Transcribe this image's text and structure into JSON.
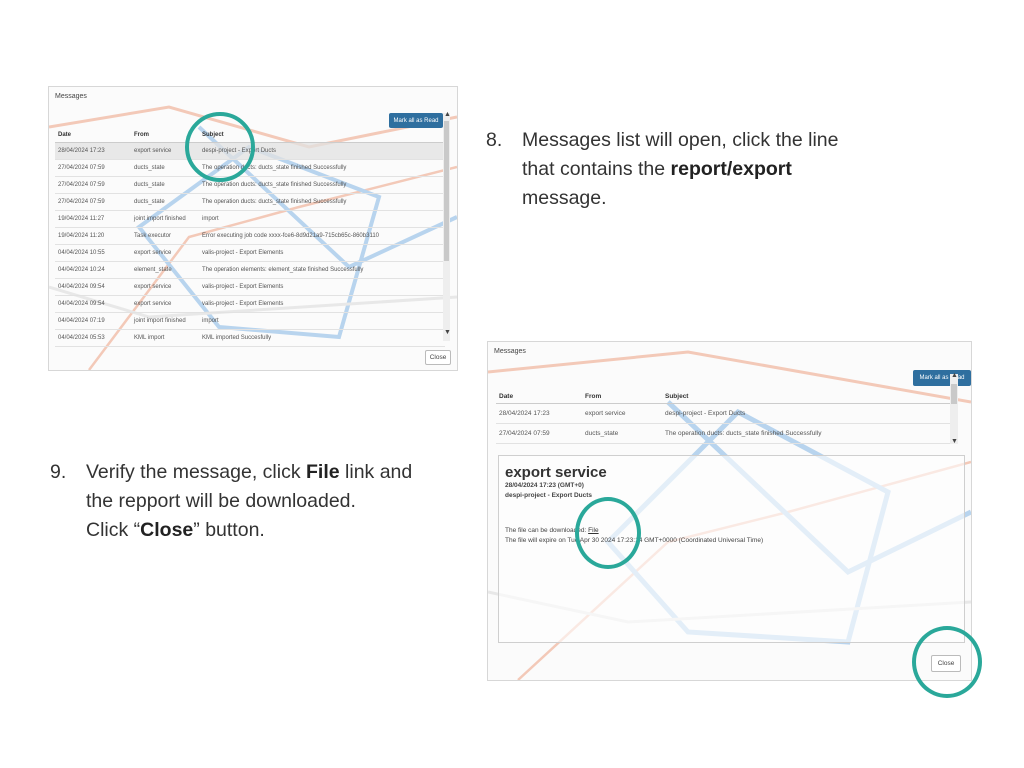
{
  "accent_color": "#2aa89a",
  "messages_dialog": {
    "title": "Messages",
    "mark_all_read": "Mark all as Read",
    "close": "Close",
    "columns": [
      "Date",
      "From",
      "Subject"
    ],
    "rows": [
      {
        "date": "28/04/2024 17:23",
        "from": "export service",
        "subject": "despi-project - Export Ducts",
        "selected": true
      },
      {
        "date": "27/04/2024 07:59",
        "from": "ducts_state",
        "subject": "The operation ducts: ducts_state finished Successfully"
      },
      {
        "date": "27/04/2024 07:59",
        "from": "ducts_state",
        "subject": "The operation ducts: ducts_state finished Successfully"
      },
      {
        "date": "27/04/2024 07:59",
        "from": "ducts_state",
        "subject": "The operation ducts: ducts_state finished Successfully"
      },
      {
        "date": "19/04/2024 11:27",
        "from": "joint import finished",
        "subject": "import"
      },
      {
        "date": "19/04/2024 11:20",
        "from": "Task executor",
        "subject": "Error executing job code xxxx-fce6-8d9d21a9-715cb65c-860b3110"
      },
      {
        "date": "04/04/2024 10:55",
        "from": "export service",
        "subject": "valis-project - Export Elements"
      },
      {
        "date": "04/04/2024 10:24",
        "from": "element_state",
        "subject": "The operation elements: element_state finished Successfully"
      },
      {
        "date": "04/04/2024 09:54",
        "from": "export service",
        "subject": "valis-project - Export Elements"
      },
      {
        "date": "04/04/2024 09:54",
        "from": "export service",
        "subject": "valis-project - Export Elements"
      },
      {
        "date": "04/04/2024 07:19",
        "from": "joint import finished",
        "subject": "import"
      },
      {
        "date": "04/04/2024 05:53",
        "from": "KML import",
        "subject": "KML imported Succesfully"
      }
    ]
  },
  "detail_dialog": {
    "title": "Messages",
    "mark_all_read": "Mark all as Read",
    "close": "Close",
    "columns": [
      "Date",
      "From",
      "Subject"
    ],
    "rows": [
      {
        "date": "28/04/2024 17:23",
        "from": "export service",
        "subject": "despi-project - Export Ducts"
      },
      {
        "date": "27/04/2024 07:59",
        "from": "ducts_state",
        "subject": "The operation ducts: ducts_state finished Successfully"
      }
    ],
    "message": {
      "heading": "export service",
      "date_line": "28/04/2024 17:23 (GMT+0)",
      "subject_line": "despi-project - Export Ducts",
      "body_prefix": "The file can be downloaded: ",
      "file_link": "File",
      "expiry": "The file will expire on Tue Apr 30 2024 17:23:14 GMT+0000 (Coordinated Universal Time)"
    }
  },
  "steps": {
    "step8": {
      "number": "8.",
      "text_a": "Messages list will open, click the line",
      "text_b": "that contains the ",
      "bold": "report/export",
      "text_c": "message."
    },
    "step9": {
      "number": "9.",
      "text_a": "Verify the message, click ",
      "bold_a": "File",
      "text_b": " link and",
      "text_c": "the repport will be downloaded.",
      "text_d": " Click “",
      "bold_b": "Close",
      "text_e": "” button."
    }
  }
}
